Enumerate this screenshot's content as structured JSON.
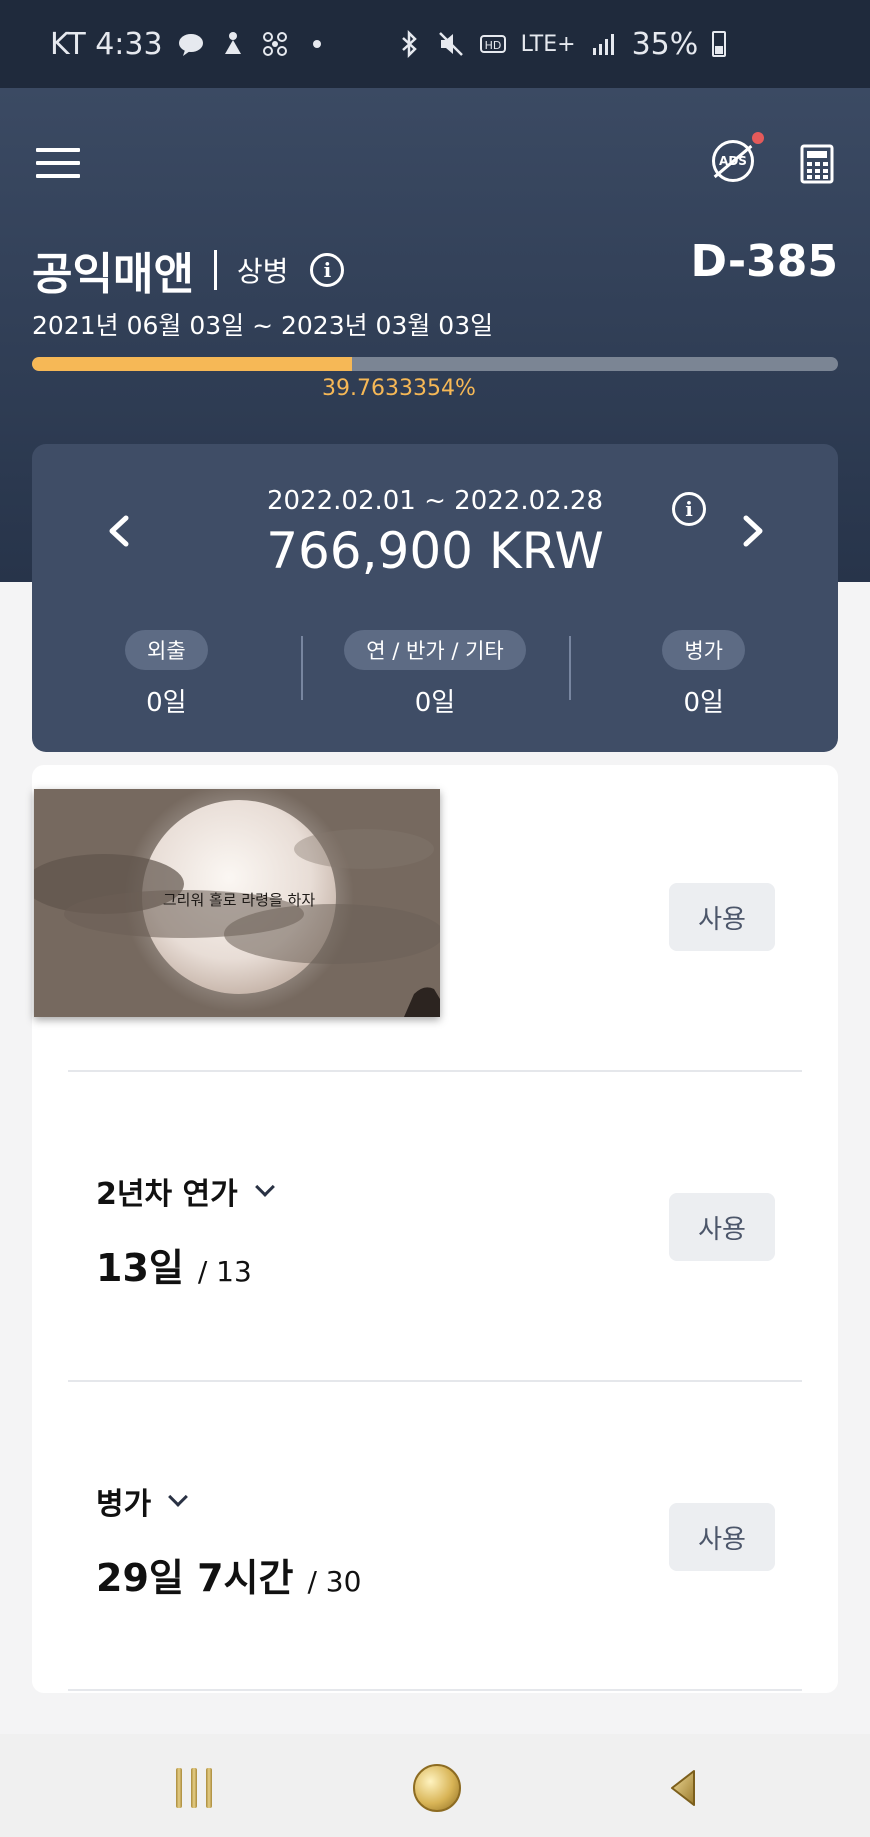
{
  "status_bar": {
    "carrier_time": "KT 4:33",
    "network": "LTE+",
    "battery": "35%"
  },
  "header": {
    "title": "공익매앤",
    "rank": "상병",
    "dday": "D-385",
    "period": "2021년 06월 03일  ~  2023년 03월 03일",
    "progress_percent": 39.7633354,
    "progress_label": "39.7633354%",
    "ads_label": "ADS"
  },
  "salary_card": {
    "range": "2022.02.01 ~ 2022.02.28",
    "amount": "766,900 KRW",
    "stats": [
      {
        "label": "외출",
        "value": "0일"
      },
      {
        "label": "연 / 반가 / 기타",
        "value": "0일"
      },
      {
        "label": "병가",
        "value": "0일"
      }
    ]
  },
  "banner": {
    "caption": "그리워 홀로 라령을 하자"
  },
  "leave_items": [
    {
      "title": "2년차 연가",
      "count": "13일",
      "total": "/ 13"
    },
    {
      "title": "병가",
      "count": "29일 7시간",
      "total": "/ 30"
    }
  ],
  "use_label": "사용",
  "colors": {
    "header_bg": "#3b4a63",
    "card_bg": "#3f4d66",
    "progress_fill": "#f6b856",
    "progress_track": "#7b8594",
    "notification_dot": "#e45a5a"
  },
  "icons": [
    "menu-icon",
    "ads-block-icon",
    "calculator-icon",
    "info-icon",
    "chevron-left-icon",
    "chevron-right-icon",
    "chevron-down-icon",
    "recent-apps-icon",
    "home-icon",
    "back-icon"
  ]
}
